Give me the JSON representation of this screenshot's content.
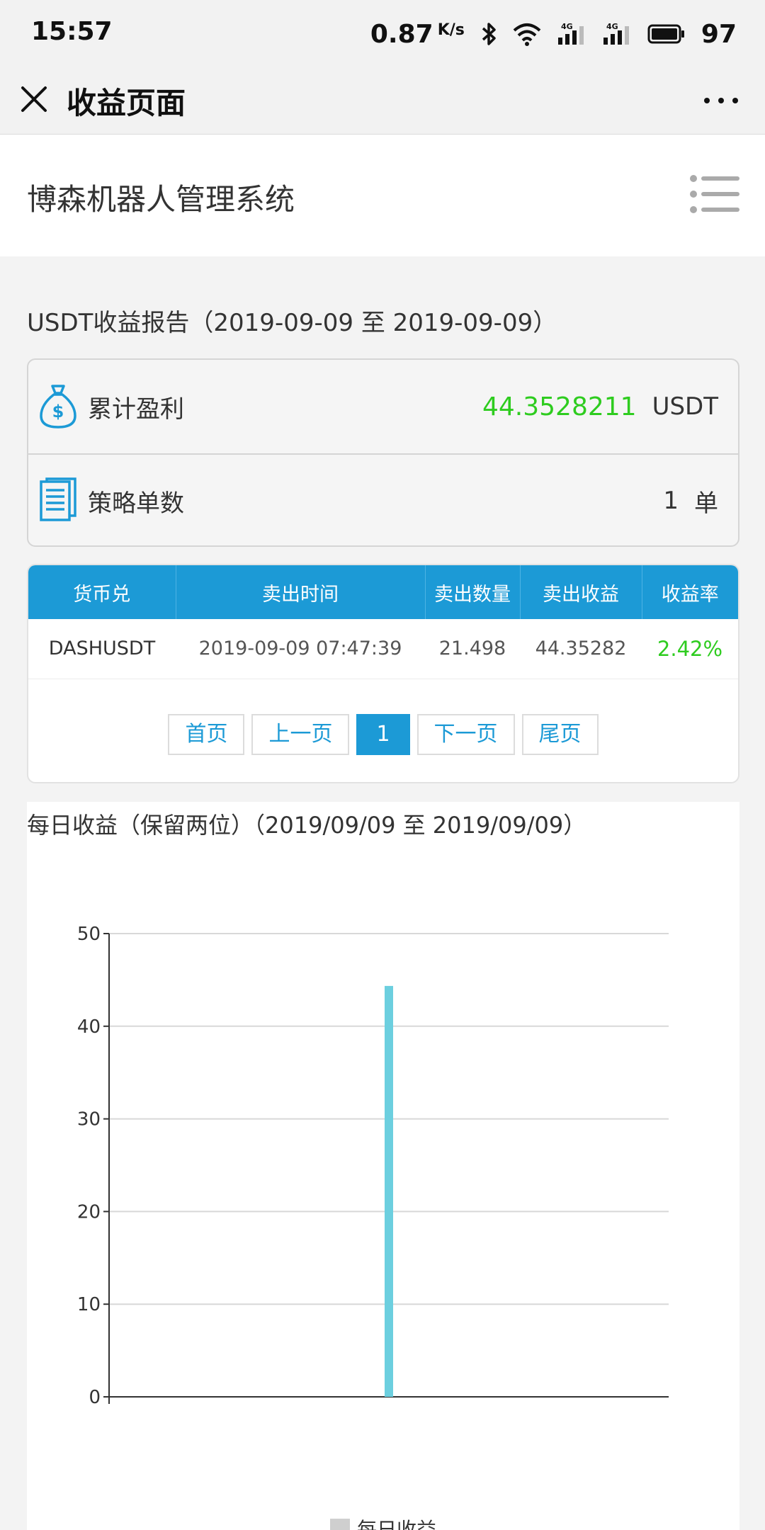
{
  "status_bar": {
    "time": "15:57",
    "speed": "0.87",
    "speed_unit": "K/s",
    "battery": "97"
  },
  "nav": {
    "title": "收益页面"
  },
  "header": {
    "app_title": "博森机器人管理系统"
  },
  "report": {
    "title": "USDT收益报告（2019-09-09 至 2019-09-09）"
  },
  "summary": {
    "profit_label": "累计盈利",
    "profit_value": "44.3528211",
    "profit_unit": "USDT",
    "orders_label": "策略单数",
    "orders_value": "1",
    "orders_unit": "单"
  },
  "table": {
    "headers": [
      "货币兑",
      "卖出时间",
      "卖出数量",
      "卖出收益",
      "收益率"
    ],
    "rows": [
      [
        "DASHUSDT",
        "2019-09-09 07:47:39",
        "21.498",
        "44.35282",
        "2.42%"
      ]
    ]
  },
  "pager": {
    "first": "首页",
    "prev": "上一页",
    "current": "1",
    "next": "下一页",
    "last": "尾页"
  },
  "chart_data": {
    "type": "bar",
    "title": "每日收益（保留两位）（2019/09/09 至 2019/09/09）",
    "categories": [
      ""
    ],
    "series": [
      {
        "name": "每日收益",
        "values": [
          44.35
        ]
      }
    ],
    "yticks": [
      "0",
      "10",
      "20",
      "30",
      "40",
      "50"
    ],
    "ylim": [
      0,
      50
    ],
    "grid": true,
    "legend": "bottom",
    "bar_color": "#6ccfdf"
  },
  "colors": {
    "accent": "#1c9ad6",
    "positive": "#2ecc1f"
  }
}
